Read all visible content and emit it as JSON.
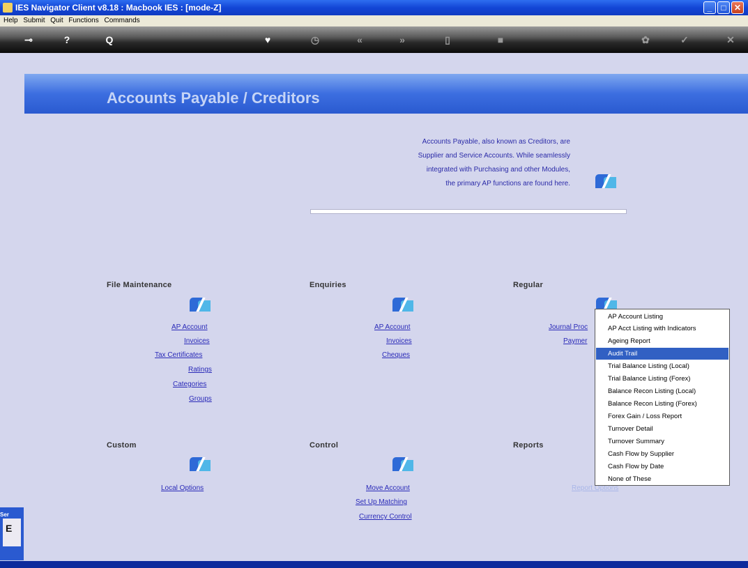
{
  "window": {
    "title": "IES Navigator Client v8.18 : Macbook IES :      [mode-Z]"
  },
  "menubar": {
    "items": [
      "Help",
      "Submit",
      "Quit",
      "Functions",
      "Commands"
    ]
  },
  "toolbar": {
    "icons": [
      "key-icon",
      "help-icon",
      "search-icon",
      "heart-icon",
      "clock-icon",
      "back-icon",
      "forward-icon",
      "pause-icon",
      "stop-icon",
      "refresh-icon",
      "ok-icon",
      "close-icon"
    ]
  },
  "page": {
    "title": "Accounts Payable / Creditors",
    "intro": [
      "Accounts Payable, also known as Creditors, are",
      "Supplier and Service Accounts. While seamlessly",
      "integrated with Purchasing and other Modules,",
      "the primary AP functions are found here."
    ]
  },
  "sections": {
    "file_maintenance": {
      "title": "File Maintenance",
      "links": [
        "AP Account",
        "Invoices",
        "Tax Certificates",
        "Ratings",
        "Categories",
        "Groups"
      ]
    },
    "enquiries": {
      "title": "Enquiries",
      "links": [
        "AP Account",
        "Invoices",
        "Cheques"
      ]
    },
    "regular": {
      "title": "Regular",
      "links": [
        "Journal Proc",
        "Paymer"
      ]
    },
    "custom": {
      "title": "Custom",
      "links": [
        "Local Options"
      ]
    },
    "control": {
      "title": "Control",
      "links": [
        "Move Account",
        "Set Up Matching",
        "Currency Control"
      ]
    },
    "reports": {
      "title": "Reports",
      "links": [
        "Report Options"
      ]
    }
  },
  "dropdown": {
    "items": [
      "AP Account Listing",
      "AP Acct Listing with Indicators",
      "Ageing Report",
      "Audit Trail",
      "Trial Balance Listing (Local)",
      "Trial Balance Listing (Forex)",
      "Balance Recon Listing (Local)",
      "Balance Recon Listing (Forex)",
      "Forex Gain / Loss Report",
      "Turnover Detail",
      "Turnover Summary",
      "Cash Flow by Supplier",
      "Cash Flow by Date",
      "None of These"
    ],
    "selected": "Audit Trail"
  },
  "left_tab": {
    "label": "Ser",
    "letter": "E"
  },
  "colors": {
    "accent": "#3c6ee0",
    "selection": "#3160c3",
    "link": "#2a2ab8"
  }
}
